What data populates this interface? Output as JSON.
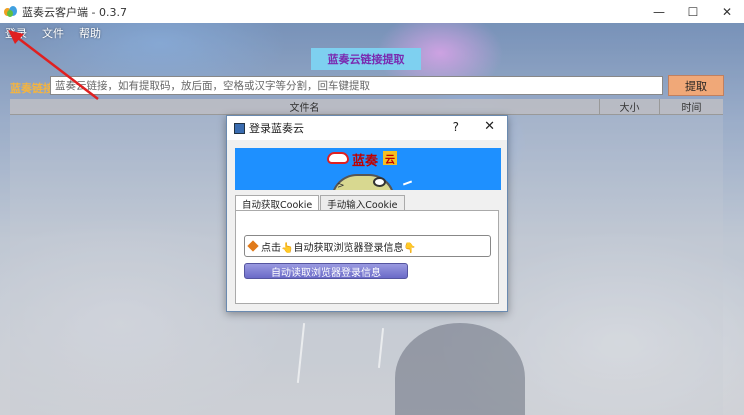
{
  "window": {
    "title": "蓝奏云客户端 - 0.3.7",
    "minimize_glyph": "—",
    "maximize_glyph": "☐",
    "close_glyph": "✕"
  },
  "menu": {
    "items": [
      "登录",
      "文件",
      "帮助"
    ]
  },
  "banner": {
    "label": "蓝奏云链接提取"
  },
  "link_bar": {
    "label": "蓝奏链接",
    "placeholder": "蓝奏云链接，如有提取码，放后面，空格或汉字等分割，回车键提取",
    "extract_button": "提取"
  },
  "table": {
    "columns": [
      "文件名",
      "大小",
      "时间"
    ]
  },
  "login_dialog": {
    "title": "登录蓝奏云",
    "help_glyph": "?",
    "close_glyph": "✕",
    "logo_text": "蓝奏",
    "logo_box_text": "云",
    "mascot_mark": ">",
    "tabs": [
      {
        "label": "自动获取Cookie",
        "active": true
      },
      {
        "label": "手动输入Cookie",
        "active": false
      }
    ],
    "status_text": "点击👆自动获取浏览器登录信息👇",
    "read_button": "自动读取浏览器登录信息"
  },
  "icons": {
    "app": "lanzou-cloud-icon",
    "dialog": "login-dialog-icon",
    "annotation": "red-arrow"
  },
  "colors": {
    "banner_bg": "#7ed0f0",
    "banner_text": "#7a2ab0",
    "link_label": "#f4b440",
    "extract_button": "#f0a878",
    "dialog_banner": "#1e90ff",
    "read_button": "#7a7ad0",
    "arrow": "#e02020"
  }
}
